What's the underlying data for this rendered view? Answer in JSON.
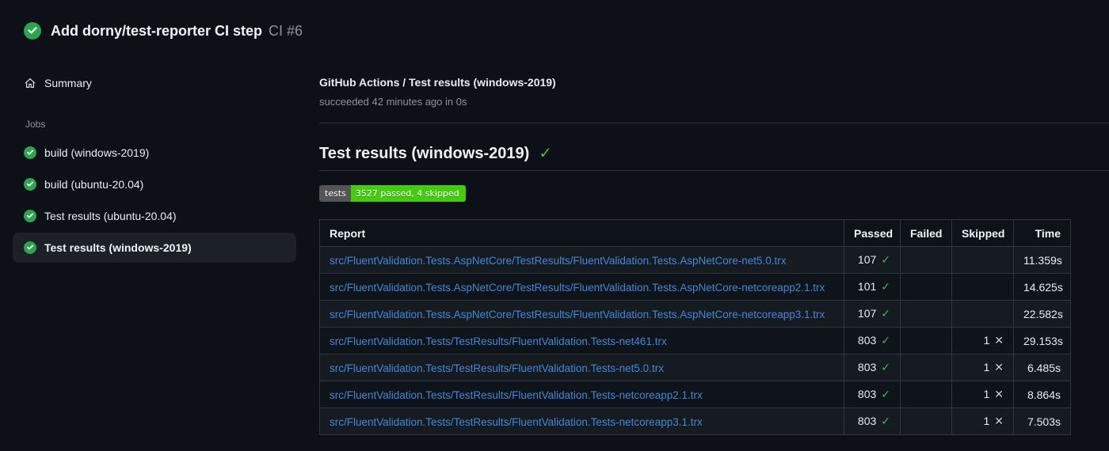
{
  "header": {
    "title": "Add dorny/test-reporter CI step",
    "run_number": "CI #6",
    "status": "success"
  },
  "sidebar": {
    "summary_label": "Summary",
    "jobs_section_label": "Jobs",
    "jobs": [
      {
        "label": "build (windows-2019)",
        "status": "success",
        "selected": false
      },
      {
        "label": "build (ubuntu-20.04)",
        "status": "success",
        "selected": false
      },
      {
        "label": "Test results (ubuntu-20.04)",
        "status": "success",
        "selected": false
      },
      {
        "label": "Test results (windows-2019)",
        "status": "success",
        "selected": true
      }
    ]
  },
  "job_header": {
    "title": "GitHub Actions / Test results (windows-2019)",
    "status_line": "succeeded 42 minutes ago in 0s"
  },
  "report": {
    "heading": "Test results (windows-2019)",
    "badge": {
      "label": "tests",
      "value": "3527 passed, 4 skipped"
    },
    "table": {
      "columns": {
        "report": "Report",
        "passed": "Passed",
        "failed": "Failed",
        "skipped": "Skipped",
        "time": "Time"
      },
      "rows": [
        {
          "report": "src/FluentValidation.Tests.AspNetCore/TestResults/FluentValidation.Tests.AspNetCore-net5.0.trx",
          "passed": "107",
          "failed": "",
          "skipped": "",
          "time": "11.359s"
        },
        {
          "report": "src/FluentValidation.Tests.AspNetCore/TestResults/FluentValidation.Tests.AspNetCore-netcoreapp2.1.trx",
          "passed": "101",
          "failed": "",
          "skipped": "",
          "time": "14.625s"
        },
        {
          "report": "src/FluentValidation.Tests.AspNetCore/TestResults/FluentValidation.Tests.AspNetCore-netcoreapp3.1.trx",
          "passed": "107",
          "failed": "",
          "skipped": "",
          "time": "22.582s"
        },
        {
          "report": "src/FluentValidation.Tests/TestResults/FluentValidation.Tests-net461.trx",
          "passed": "803",
          "failed": "",
          "skipped": "1",
          "time": "29.153s"
        },
        {
          "report": "src/FluentValidation.Tests/TestResults/FluentValidation.Tests-net5.0.trx",
          "passed": "803",
          "failed": "",
          "skipped": "1",
          "time": "6.485s"
        },
        {
          "report": "src/FluentValidation.Tests/TestResults/FluentValidation.Tests-netcoreapp2.1.trx",
          "passed": "803",
          "failed": "",
          "skipped": "1",
          "time": "8.864s"
        },
        {
          "report": "src/FluentValidation.Tests/TestResults/FluentValidation.Tests-netcoreapp3.1.trx",
          "passed": "803",
          "failed": "",
          "skipped": "1",
          "time": "7.503s"
        }
      ]
    }
  },
  "colors": {
    "background": "#0d1117",
    "success_green": "#3fb950",
    "status_circle_green": "#2da44e",
    "link_blue": "#4287d8",
    "badge_label_bg": "#555555",
    "badge_value_bg": "#44cc11",
    "border": "#30363d",
    "secondary_text": "#8b949e"
  }
}
